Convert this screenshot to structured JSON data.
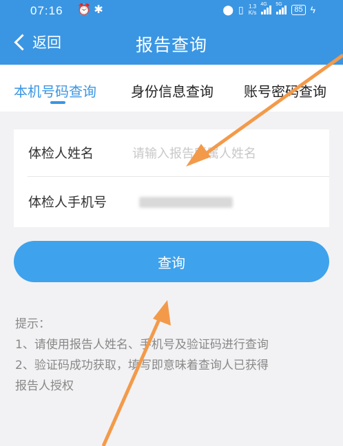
{
  "status_bar": {
    "time": "07:16",
    "speed_value": "1.3",
    "speed_unit": "K/s",
    "net_1": "4G",
    "net_2": "5G",
    "battery": "85"
  },
  "nav": {
    "back_label": "返回",
    "title": "报告查询"
  },
  "tabs": [
    {
      "label": "本机号码查询"
    },
    {
      "label": "身份信息查询"
    },
    {
      "label": "账号密码查询"
    }
  ],
  "form": {
    "name_label": "体检人姓名",
    "name_placeholder": "请输入报告所属人姓名",
    "phone_label": "体检人手机号"
  },
  "query_button": "查询",
  "tips": {
    "title": "提示：",
    "lines": [
      "1、请使用报告人姓名、手机号及验证码进行查询",
      "2、验证码成功获取，填写即意味着查询人已获得",
      "报告人授权"
    ]
  },
  "colors": {
    "primary": "#3a96e3",
    "button": "#3fa2ec",
    "annotation_arrow": "#f39a4a"
  }
}
